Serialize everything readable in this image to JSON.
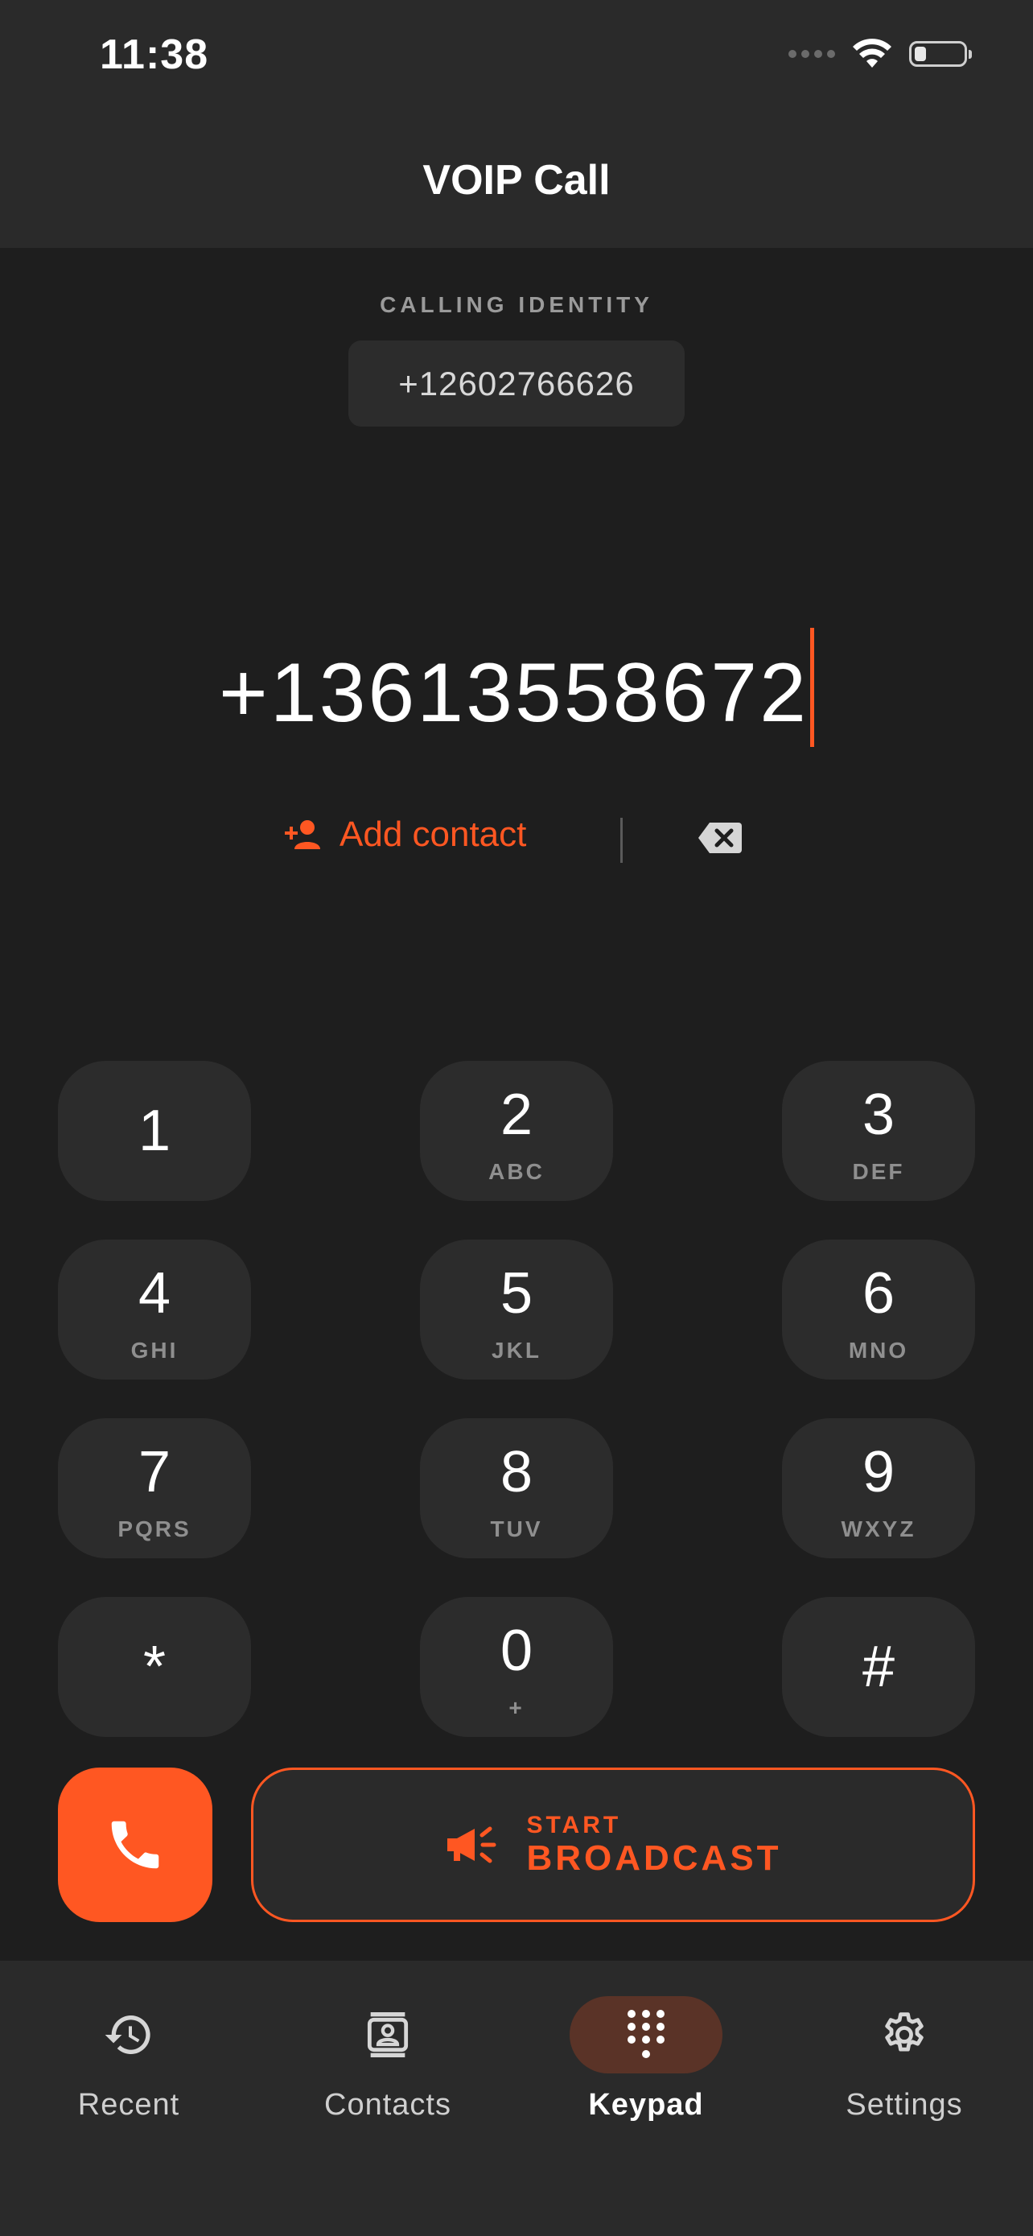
{
  "status_bar": {
    "time": "11:38"
  },
  "header": {
    "title": "VOIP Call"
  },
  "identity": {
    "label": "CALLING IDENTITY",
    "number": "+12602766626"
  },
  "dialer": {
    "number": "+13613558672"
  },
  "actions": {
    "add_contact_label": "Add contact"
  },
  "keypad": {
    "keys": [
      {
        "digit": "1",
        "letters": ""
      },
      {
        "digit": "2",
        "letters": "ABC"
      },
      {
        "digit": "3",
        "letters": "DEF"
      },
      {
        "digit": "4",
        "letters": "GHI"
      },
      {
        "digit": "5",
        "letters": "JKL"
      },
      {
        "digit": "6",
        "letters": "MNO"
      },
      {
        "digit": "7",
        "letters": "PQRS"
      },
      {
        "digit": "8",
        "letters": "TUV"
      },
      {
        "digit": "9",
        "letters": "WXYZ"
      },
      {
        "digit": "*",
        "letters": ""
      },
      {
        "digit": "0",
        "letters": "+"
      },
      {
        "digit": "#",
        "letters": ""
      }
    ]
  },
  "broadcast": {
    "small": "START",
    "big": "BROADCAST"
  },
  "tabs": [
    {
      "label": "Recent",
      "icon": "history-icon"
    },
    {
      "label": "Contacts",
      "icon": "contacts-icon"
    },
    {
      "label": "Keypad",
      "icon": "dialpad-icon"
    },
    {
      "label": "Settings",
      "icon": "gear-icon"
    }
  ],
  "colors": {
    "accent": "#ff5722",
    "background": "#1e1e1e",
    "surface": "#2c2c2c",
    "active_tab_bg": "#5a3327"
  }
}
